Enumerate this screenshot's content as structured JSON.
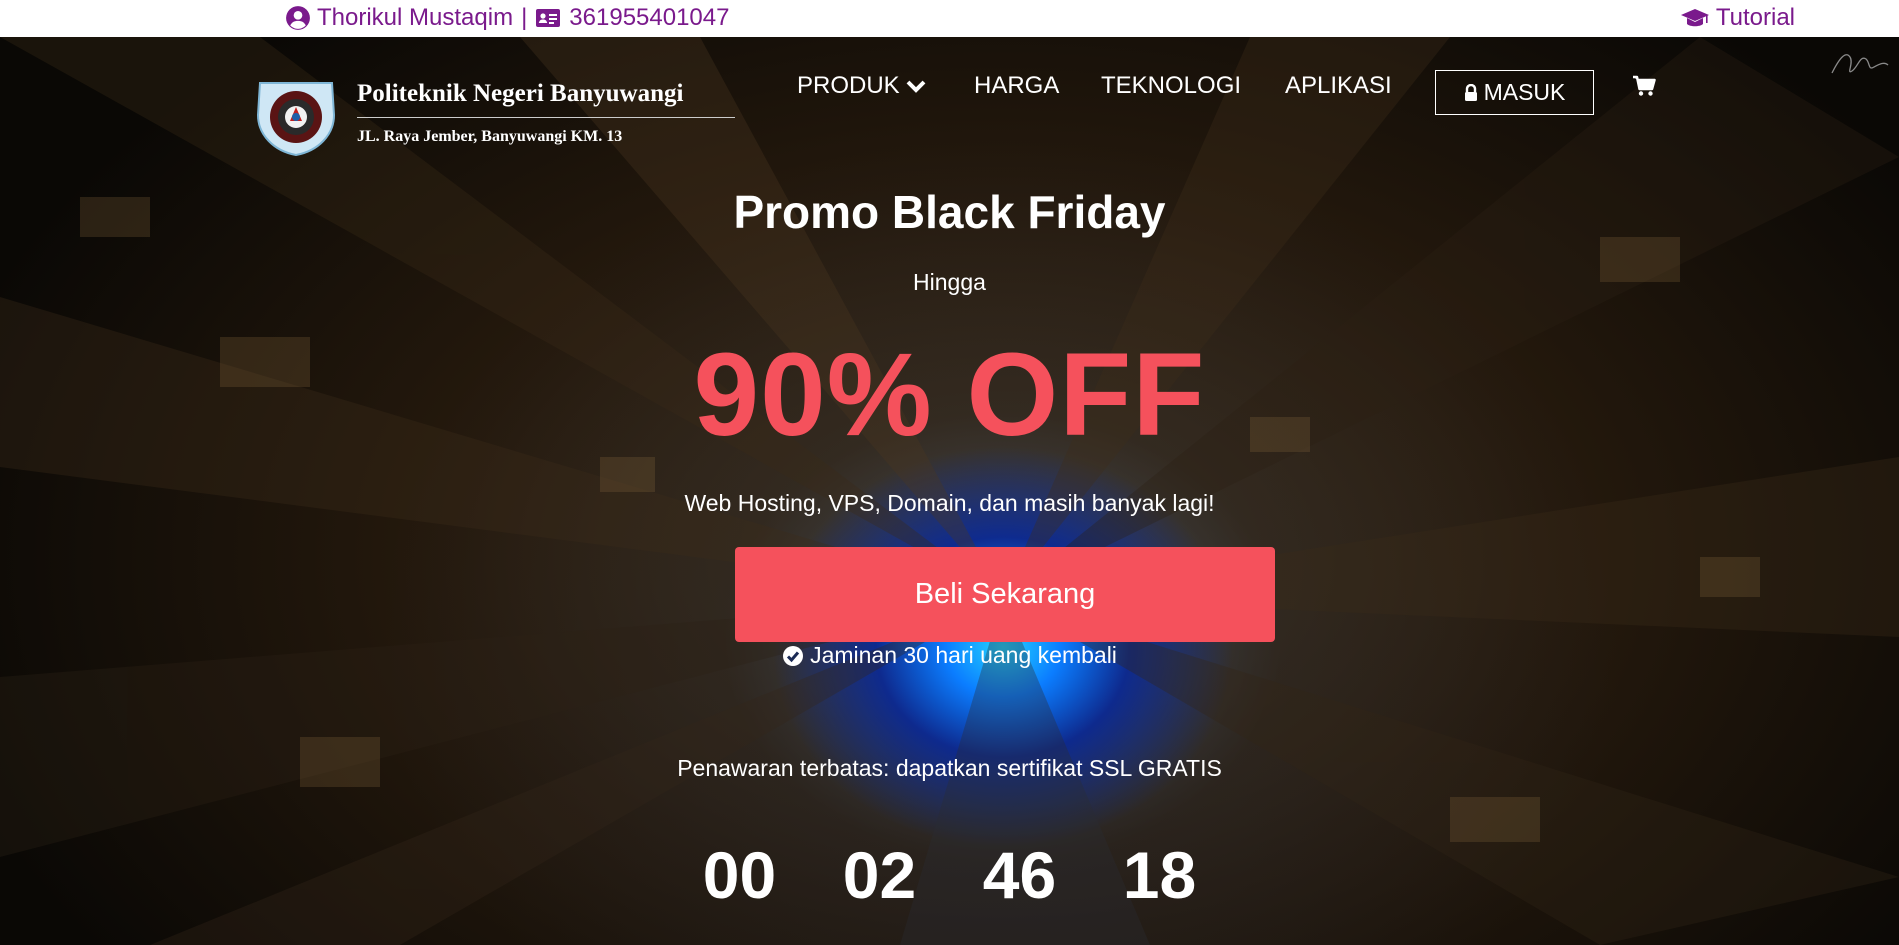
{
  "topbar": {
    "user_name": "Thorikul Mustaqim",
    "separator": "|",
    "id_number": "361955401047",
    "tutorial": "Tutorial",
    "text_color": "#7a1a8c"
  },
  "brand": {
    "name": "Politeknik Negeri Banyuwangi",
    "address": "JL. Raya Jember, Banyuwangi KM. 13"
  },
  "nav": {
    "produk": "PRODUK",
    "harga": "HARGA",
    "teknologi": "TEKNOLOGI",
    "aplikasi": "APLIKASI",
    "masuk": "MASUK"
  },
  "hero": {
    "title": "Promo Black Friday",
    "until": "Hingga",
    "discount": "90% OFF",
    "services": "Web Hosting, VPS, Domain, dan masih banyak lagi!",
    "buy_button": "Beli Sekarang",
    "guarantee": "Jaminan 30 hari uang kembali",
    "offer": "Penawaran terbatas: dapatkan sertifikat SSL GRATIS",
    "accent_color": "#f5515c"
  },
  "countdown": {
    "days": "00",
    "hours": "02",
    "minutes": "46",
    "seconds": "18"
  },
  "icons": [
    "user-circle-icon",
    "id-card-icon",
    "graduation-cap-icon",
    "chevron-down-icon",
    "lock-icon",
    "cart-icon",
    "check-circle-icon",
    "signature-icon"
  ]
}
